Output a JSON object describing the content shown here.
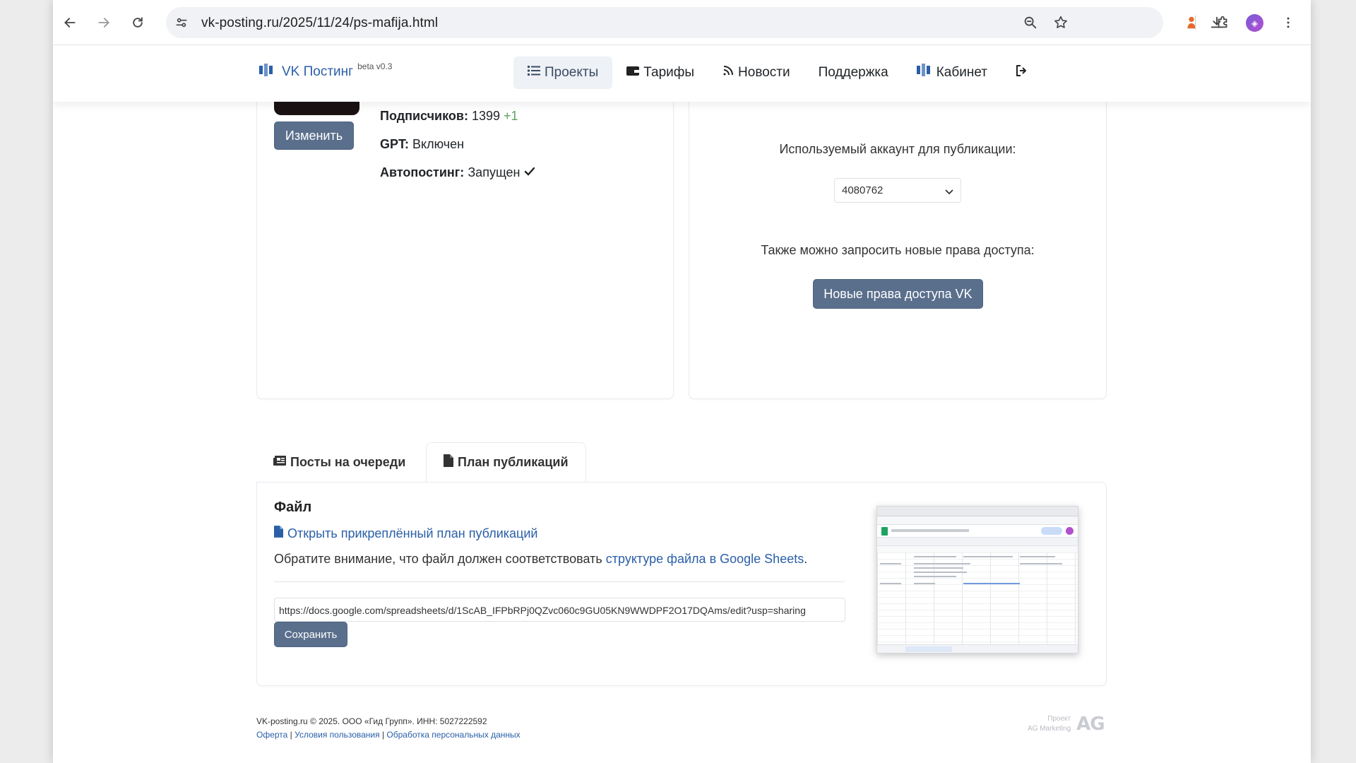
{
  "browser": {
    "url": "vk-posting.ru/2025/11/24/ps-mafija.html"
  },
  "header": {
    "brand": "VK Постинг",
    "beta": "beta v0.3",
    "menu": [
      {
        "label": "Проекты",
        "icon": "list-icon",
        "active": true
      },
      {
        "label": "Тарифы",
        "icon": "wallet-icon"
      },
      {
        "label": "Новости",
        "icon": "rss-icon"
      },
      {
        "label": "Поддержка"
      },
      {
        "label": "Кабинет",
        "icon": "cabinet-logo-icon"
      }
    ],
    "logout_icon": "sign-out-icon"
  },
  "project": {
    "edit_label": "Изменить",
    "subscribers_label": "Подписчиков:",
    "subscribers_value": "1399",
    "subscribers_delta": "+1",
    "gpt_label": "GPT:",
    "gpt_value": "Включен",
    "autopost_label": "Автопостинг:",
    "autopost_value": "Запущен"
  },
  "account": {
    "label": "Используемый аккаунт для публикации:",
    "selected": "4080762",
    "rights_text": "Также можно запросить новые права доступа:",
    "rights_button": "Новые права доступа VK"
  },
  "tabs": [
    {
      "label": "Посты на очереди",
      "icon": "newspaper-icon",
      "active": false
    },
    {
      "label": "План публикаций",
      "icon": "file-icon",
      "active": true
    }
  ],
  "plan": {
    "heading": "Файл",
    "open_link": "Открыть прикреплённый план публикаций",
    "note_prefix": "Обратите внимание, что файл должен соответствовать ",
    "note_link": "структуре файла в Google Sheets",
    "note_suffix": ".",
    "sheet_url": "https://docs.google.com/spreadsheets/d/1ScAB_IFPbRPj0QZvc060c9GU05KN9WWDPF2O17DQAms/edit?usp=sharing",
    "save_label": "Сохранить"
  },
  "footer": {
    "copyright": "VK-posting.ru © 2025. ООО «Гид Групп». ИНН: 5027222592",
    "links": [
      "Оферта",
      "Условия пользования",
      "Обработка персональных данных"
    ],
    "separator": " | ",
    "project_label": "Проект",
    "company_label": "AG Marketing",
    "logo_text": "AG"
  },
  "colors": {
    "accent": "#2a5fa8",
    "button": "#5a6f8c",
    "positive": "#5ea35a"
  }
}
